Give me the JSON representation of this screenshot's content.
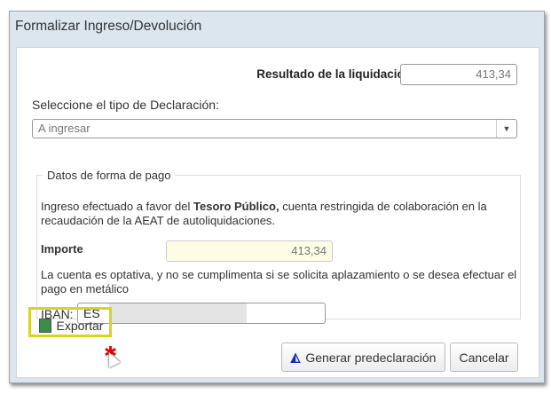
{
  "dialog": {
    "title": "Formalizar Ingreso/Devolución"
  },
  "resultado": {
    "label": "Resultado de la liquidación",
    "value": "413,34"
  },
  "tipo": {
    "label": "Seleccione el tipo de Declaración:",
    "selected": "A ingresar"
  },
  "pago": {
    "legend": "Datos de forma de pago",
    "text_pre": "Ingreso efectuado a favor del ",
    "text_bold": "Tesoro Público,",
    "text_post": " cuenta restringida de colaboración en la recaudación de la AEAT de autoliquidaciones.",
    "importe_label": "Importe",
    "importe_value": "413,34",
    "note": "La cuenta es optativa, y no se cumplimenta si se solicita aplazamiento o se desea efectuar el pago en metálico",
    "iban_label": "IBAN:",
    "iban_value": "ES"
  },
  "buttons": {
    "exportar": "Exportar",
    "generar": "Generar predeclaración",
    "cancelar": "Cancelar"
  },
  "colors": {
    "highlight": "#d9d324",
    "titlebar": "#dce6ef"
  }
}
